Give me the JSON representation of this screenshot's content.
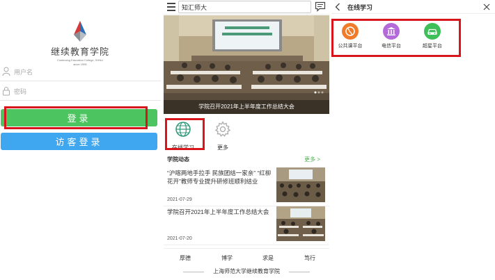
{
  "login": {
    "logo_name": "继续教育学院",
    "logo_subtitle": "Continuing Education College, SHNU",
    "logo_since": "since 1955",
    "username_placeholder": "用户名",
    "password_placeholder": "密码",
    "login_button": "登录",
    "guest_button": "访客登录"
  },
  "home": {
    "search_text": "知汇师大",
    "banner_caption": "学院召开2021年上半年度工作总结大会",
    "quick_links": [
      {
        "label": "在线学习",
        "icon": "globe-icon"
      },
      {
        "label": "更多",
        "icon": "gear-icon"
      }
    ],
    "section_title": "学院动态",
    "section_more": "更多 >",
    "news": [
      {
        "title": "“沪喀两地手拉手 民族团结一家亲” “红柳花开”教师专业提升研修班顺利结业",
        "date": "2021-07-29"
      },
      {
        "title": "学院召开2021年上半年度工作总结大会",
        "date": "2021-07-20"
      }
    ],
    "footer_tabs": [
      "厚德",
      "博学",
      "求是",
      "笃行"
    ],
    "footer_text": "上海师范大学继续教育学院"
  },
  "learn": {
    "title": "在线学习",
    "platforms": [
      {
        "label": "公共课平台",
        "color": "#f07b2b",
        "icon": "globe-icon"
      },
      {
        "label": "电信平台",
        "color": "#b46ad8",
        "icon": "building-icon"
      },
      {
        "label": "超星平台",
        "color": "#3fbf5a",
        "icon": "car-icon"
      }
    ]
  },
  "colors": {
    "highlight": "#d8151b",
    "login_green": "#4cc45f",
    "guest_blue": "#3ea7ef",
    "more_green": "#4cb050"
  }
}
